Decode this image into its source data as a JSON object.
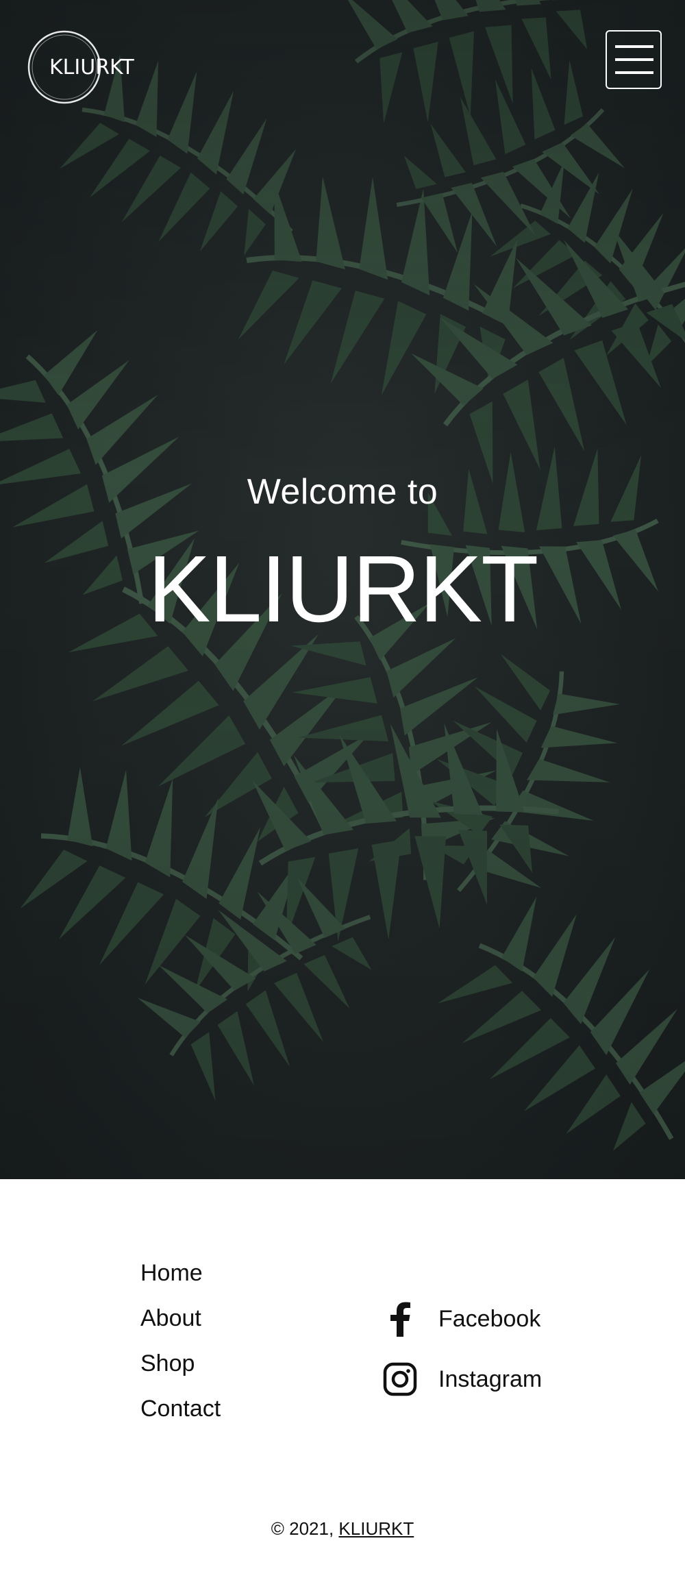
{
  "header": {
    "logo_text": "KLIURKT",
    "menu_icon": "hamburger-menu-icon"
  },
  "hero": {
    "welcome": "Welcome to",
    "title": "KLIURKT"
  },
  "footer": {
    "nav": {
      "items": [
        {
          "label": "Home"
        },
        {
          "label": "About"
        },
        {
          "label": "Shop"
        },
        {
          "label": "Contact"
        }
      ]
    },
    "social": {
      "items": [
        {
          "label": "Facebook",
          "icon": "facebook-icon"
        },
        {
          "label": "Instagram",
          "icon": "instagram-icon"
        }
      ]
    },
    "copyright": {
      "prefix": "© 2021, ",
      "link": "KLIURKT"
    }
  },
  "colors": {
    "hero_bg": "#1f2526",
    "foliage": "#3d5a45",
    "text_light": "#ffffff",
    "text_dark": "#111111",
    "footer_bg": "#ffffff"
  }
}
